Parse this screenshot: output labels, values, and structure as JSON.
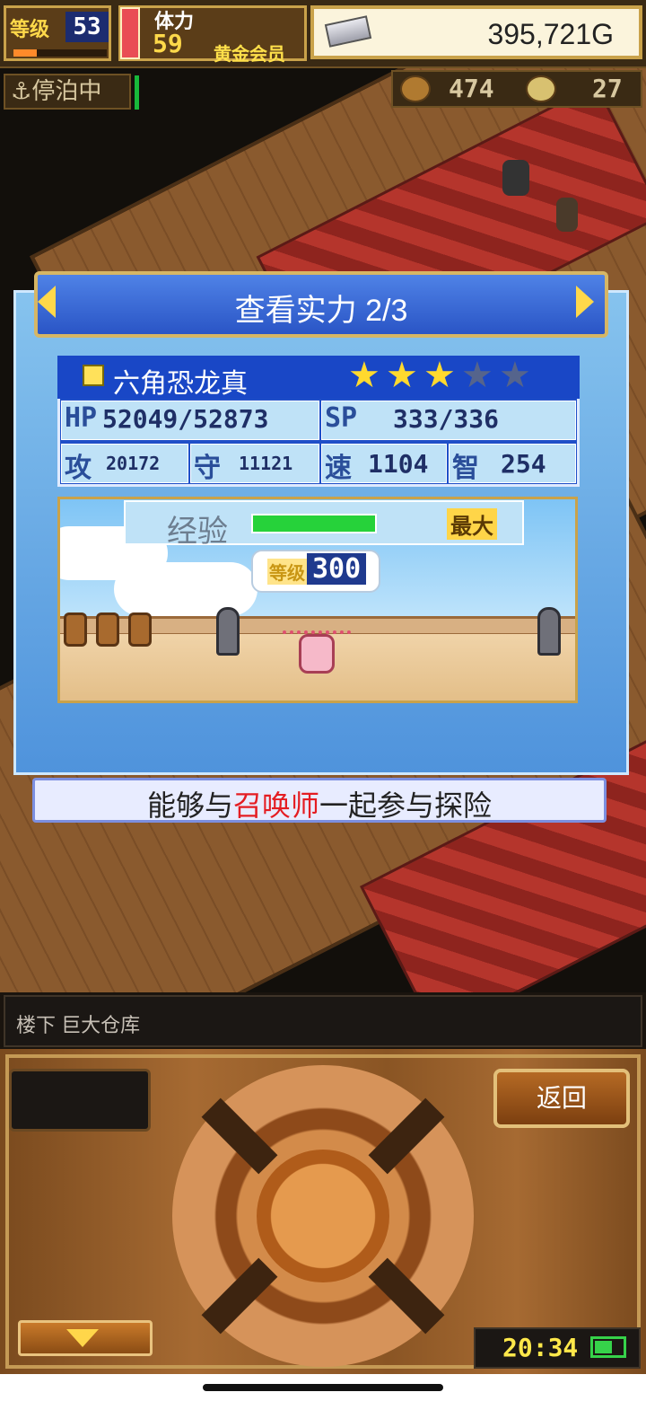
{
  "hud": {
    "level_label": "等级",
    "level_value": "53",
    "level_progress": 0.25,
    "stamina_label": "体力",
    "stamina_value": "59",
    "member_label": "黄金会员",
    "gold_value": "395,721G",
    "dock_status": "停泊中",
    "res1_value": "474",
    "res2_value": "27"
  },
  "dialog": {
    "title": "查看实力 2/3",
    "character": {
      "name": "六角恐龙真",
      "stars_filled": 3,
      "stars_total": 5,
      "hp_label": "HP",
      "hp_value": "52049/52873",
      "sp_label": "SP",
      "sp_value": "333/336",
      "atk_label": "攻",
      "atk_value": "20172",
      "def_label": "守",
      "def_value": "11121",
      "spd_label": "速",
      "spd_value": "1104",
      "int_label": "智",
      "int_value": "254"
    },
    "exp_label": "经验",
    "exp_progress": 1.0,
    "exp_max_label": "最大",
    "level_label": "等级",
    "level_value": "300",
    "caption_before": "能够与",
    "caption_highlight": "召唤师",
    "caption_after": "一起参与探险"
  },
  "location": "楼下 巨大仓库",
  "controls": {
    "back_label": "返回",
    "clock": "20:34",
    "battery_level": 0.6
  },
  "colors": {
    "highlight": "#e41d22",
    "stat_panel_blue": "#1f4fc8",
    "gold_text": "#ffd94a"
  }
}
